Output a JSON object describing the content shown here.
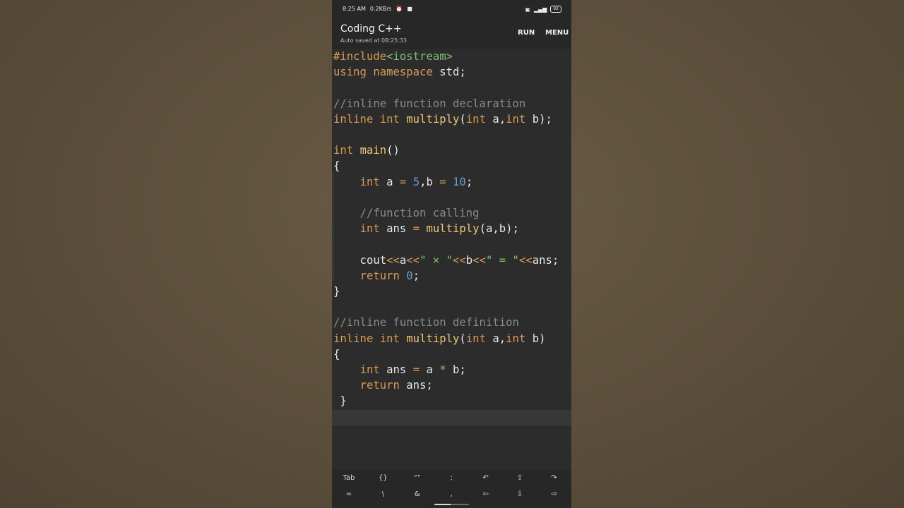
{
  "status_bar": {
    "time": "8:25 AM",
    "speed": "0.2KB/s",
    "icons_left": [
      "alarm-icon",
      "video-icon"
    ],
    "icons_right": [
      "sim-icon",
      "signal-icon"
    ],
    "battery": "92"
  },
  "app_bar": {
    "title": "Coding C++",
    "subtitle": "Auto saved at 08:25:33",
    "run_label": "RUN",
    "menu_label": "MENU"
  },
  "code_lines": [
    [
      {
        "t": "#include",
        "c": "include"
      },
      {
        "t": "<iostream>",
        "c": "header"
      }
    ],
    [
      {
        "t": "using",
        "c": "keyword"
      },
      {
        "t": " ",
        "c": "plain"
      },
      {
        "t": "namespace",
        "c": "keyword"
      },
      {
        "t": " std;",
        "c": "plain"
      }
    ],
    [],
    [
      {
        "t": "//inline function declaration",
        "c": "comment"
      }
    ],
    [
      {
        "t": "inline",
        "c": "keyword"
      },
      {
        "t": " ",
        "c": "plain"
      },
      {
        "t": "int",
        "c": "keyword"
      },
      {
        "t": " ",
        "c": "plain"
      },
      {
        "t": "multiply",
        "c": "func"
      },
      {
        "t": "(",
        "c": "plain"
      },
      {
        "t": "int",
        "c": "keyword"
      },
      {
        "t": " a,",
        "c": "plain"
      },
      {
        "t": "int",
        "c": "keyword"
      },
      {
        "t": " b);",
        "c": "plain"
      }
    ],
    [],
    [
      {
        "t": "int",
        "c": "keyword"
      },
      {
        "t": " ",
        "c": "plain"
      },
      {
        "t": "main",
        "c": "func"
      },
      {
        "t": "()",
        "c": "plain"
      }
    ],
    [
      {
        "t": "{",
        "c": "plain"
      }
    ],
    [
      {
        "t": "    ",
        "c": "plain"
      },
      {
        "t": "int",
        "c": "keyword"
      },
      {
        "t": " a ",
        "c": "plain"
      },
      {
        "t": "=",
        "c": "operator"
      },
      {
        "t": " ",
        "c": "plain"
      },
      {
        "t": "5",
        "c": "number"
      },
      {
        "t": ",b ",
        "c": "plain"
      },
      {
        "t": "=",
        "c": "operator"
      },
      {
        "t": " ",
        "c": "plain"
      },
      {
        "t": "10",
        "c": "number"
      },
      {
        "t": ";",
        "c": "plain"
      }
    ],
    [],
    [
      {
        "t": "    ",
        "c": "plain"
      },
      {
        "t": "//function calling",
        "c": "comment"
      }
    ],
    [
      {
        "t": "    ",
        "c": "plain"
      },
      {
        "t": "int",
        "c": "keyword"
      },
      {
        "t": " ans ",
        "c": "plain"
      },
      {
        "t": "=",
        "c": "operator"
      },
      {
        "t": " ",
        "c": "plain"
      },
      {
        "t": "multiply",
        "c": "func"
      },
      {
        "t": "(a,b);",
        "c": "plain"
      }
    ],
    [],
    [
      {
        "t": "    cout",
        "c": "plain"
      },
      {
        "t": "<<",
        "c": "operator"
      },
      {
        "t": "a",
        "c": "plain"
      },
      {
        "t": "<<",
        "c": "operator"
      },
      {
        "t": "\" × \"",
        "c": "string"
      },
      {
        "t": "<<",
        "c": "operator"
      },
      {
        "t": "b",
        "c": "plain"
      },
      {
        "t": "<<",
        "c": "operator"
      },
      {
        "t": "\" = \"",
        "c": "string"
      },
      {
        "t": "<<",
        "c": "operator"
      },
      {
        "t": "ans;",
        "c": "plain"
      }
    ],
    [
      {
        "t": "    ",
        "c": "plain"
      },
      {
        "t": "return",
        "c": "keyword"
      },
      {
        "t": " ",
        "c": "plain"
      },
      {
        "t": "0",
        "c": "number"
      },
      {
        "t": ";",
        "c": "plain"
      }
    ],
    [
      {
        "t": "}",
        "c": "plain"
      }
    ],
    [],
    [
      {
        "t": "//inline function definition",
        "c": "comment"
      }
    ],
    [
      {
        "t": "inline",
        "c": "keyword"
      },
      {
        "t": " ",
        "c": "plain"
      },
      {
        "t": "int",
        "c": "keyword"
      },
      {
        "t": " ",
        "c": "plain"
      },
      {
        "t": "multiply",
        "c": "func"
      },
      {
        "t": "(",
        "c": "plain"
      },
      {
        "t": "int",
        "c": "keyword"
      },
      {
        "t": " a,",
        "c": "plain"
      },
      {
        "t": "int",
        "c": "keyword"
      },
      {
        "t": " b)",
        "c": "plain"
      }
    ],
    [
      {
        "t": "{",
        "c": "plain"
      }
    ],
    [
      {
        "t": "    ",
        "c": "plain"
      },
      {
        "t": "int",
        "c": "keyword"
      },
      {
        "t": " ans ",
        "c": "plain"
      },
      {
        "t": "=",
        "c": "operator"
      },
      {
        "t": " a ",
        "c": "plain"
      },
      {
        "t": "*",
        "c": "operator"
      },
      {
        "t": " b;",
        "c": "plain"
      }
    ],
    [
      {
        "t": "    ",
        "c": "plain"
      },
      {
        "t": "return",
        "c": "keyword"
      },
      {
        "t": " ans;",
        "c": "plain"
      }
    ],
    [
      {
        "t": " }",
        "c": "plain"
      }
    ]
  ],
  "keyboard_row1": [
    {
      "label": "Tab",
      "name": "tab-key"
    },
    {
      "label": "{}",
      "name": "braces-key"
    },
    {
      "label": "“”",
      "name": "quotes-key"
    },
    {
      "label": ";",
      "name": "semicolon-key"
    },
    {
      "label": "↶",
      "name": "undo-icon"
    },
    {
      "label": "⇧",
      "name": "arrow-up-icon"
    },
    {
      "label": "↷",
      "name": "redo-icon"
    }
  ],
  "keyboard_row2": [
    {
      "label": "=",
      "name": "equals-key"
    },
    {
      "label": "\\",
      "name": "backslash-key"
    },
    {
      "label": "&",
      "name": "ampersand-key"
    },
    {
      "label": ",",
      "name": "comma-key"
    },
    {
      "label": "⇦",
      "name": "arrow-left-icon"
    },
    {
      "label": "⇩",
      "name": "arrow-down-icon"
    },
    {
      "label": "⇨",
      "name": "arrow-right-icon"
    }
  ]
}
